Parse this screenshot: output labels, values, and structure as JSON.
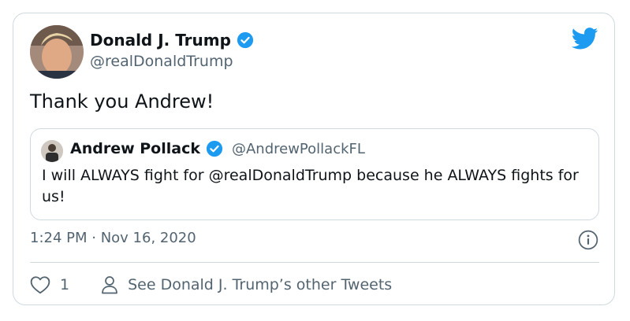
{
  "tweet": {
    "author": {
      "display_name": "Donald J. Trump",
      "handle": "@realDonaldTrump",
      "verified": true,
      "avatar_icon": "user-avatar"
    },
    "text": "Thank you Andrew!",
    "timestamp": "1:24 PM · Nov 16, 2020",
    "likes": "1",
    "see_more_label": "See Donald J. Trump’s other Tweets"
  },
  "quoted_tweet": {
    "author": {
      "display_name": "Andrew Pollack",
      "handle": "@AndrewPollackFL",
      "verified": true,
      "avatar_icon": "user-avatar"
    },
    "text": "I will ALWAYS fight for @realDonaldTrump because he ALWAYS fights for us!"
  },
  "icons": {
    "brand": "twitter-bird-icon",
    "verified": "verified-badge-icon",
    "info": "info-icon",
    "like": "heart-icon",
    "profile": "person-icon"
  },
  "colors": {
    "twitter_blue": "#1d9bf0",
    "text_primary": "#0f1419",
    "text_secondary": "#536471",
    "border": "#cfd9de"
  }
}
